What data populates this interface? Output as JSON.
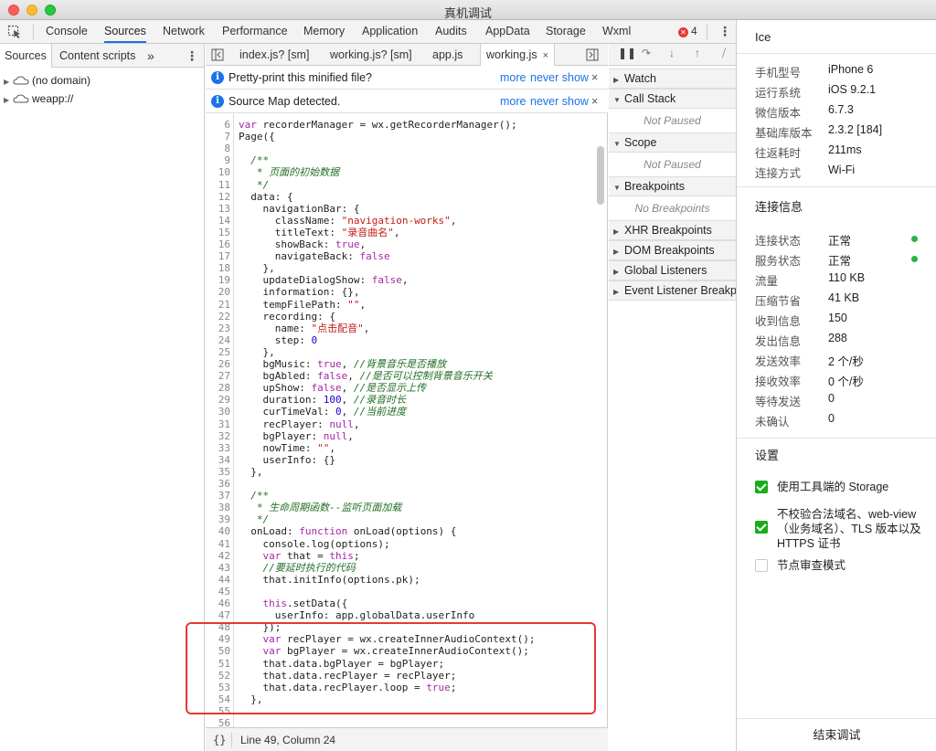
{
  "window": {
    "title": "真机调试"
  },
  "tabbar": {
    "tabs": [
      "Console",
      "Sources",
      "Network",
      "Performance",
      "Memory",
      "Application",
      "Audits",
      "AppData",
      "Storage",
      "Wxml"
    ],
    "active": "Sources",
    "error_count": "4"
  },
  "navigator": {
    "tabs": [
      "Sources",
      "Content scripts"
    ],
    "more": "»",
    "items": [
      "(no domain)",
      "weapp://"
    ]
  },
  "editor": {
    "tabs": [
      "index.js? [sm]",
      "working.js? [sm]",
      "app.js",
      "working.js"
    ],
    "close": "×",
    "infobars": [
      {
        "text": "Pretty-print this minified file?",
        "more": "more",
        "never": "never show",
        "close": "×"
      },
      {
        "text": "Source Map detected.",
        "more": "more",
        "never": "never show",
        "close": "×"
      }
    ],
    "status": {
      "braces": "{}",
      "position": "Line 49, Column 24"
    }
  },
  "debugger": {
    "sections": [
      {
        "label": "Watch",
        "expanded": false
      },
      {
        "label": "Call Stack",
        "expanded": true,
        "body": "Not Paused"
      },
      {
        "label": "Scope",
        "expanded": true,
        "body": "Not Paused"
      },
      {
        "label": "Breakpoints",
        "expanded": true,
        "body": "No Breakpoints"
      },
      {
        "label": "XHR Breakpoints",
        "expanded": false
      },
      {
        "label": "DOM Breakpoints",
        "expanded": false
      },
      {
        "label": "Global Listeners",
        "expanded": false
      },
      {
        "label": "Event Listener Breakpoints",
        "expanded": false
      }
    ]
  },
  "panel": {
    "title": "Ice",
    "device": [
      {
        "k": "手机型号",
        "v": "iPhone 6"
      },
      {
        "k": "运行系统",
        "v": "iOS 9.2.1"
      },
      {
        "k": "微信版本",
        "v": "6.7.3"
      },
      {
        "k": "基础库版本",
        "v": "2.3.2 [184]"
      },
      {
        "k": "往返耗时",
        "v": "211ms"
      },
      {
        "k": "连接方式",
        "v": "Wi-Fi"
      }
    ],
    "conn_title": "连接信息",
    "conn": [
      {
        "k": "连接状态",
        "v": "正常",
        "dot": true
      },
      {
        "k": "服务状态",
        "v": "正常",
        "dot": true
      },
      {
        "k": "流量",
        "v": "110 KB"
      },
      {
        "k": "压缩节省",
        "v": "41 KB"
      },
      {
        "k": "收到信息",
        "v": "150"
      },
      {
        "k": "发出信息",
        "v": "288"
      },
      {
        "k": "发送效率",
        "v": "2 个/秒"
      },
      {
        "k": "接收效率",
        "v": "0 个/秒"
      },
      {
        "k": "等待发送",
        "v": "0"
      },
      {
        "k": "未确认",
        "v": "0"
      }
    ],
    "settings_title": "设置",
    "settings": [
      {
        "label": "使用工具端的 Storage",
        "checked": true
      },
      {
        "label": "不校验合法域名、web-view（业务域名）、TLS 版本以及 HTTPS 证书",
        "checked": true
      },
      {
        "label": "节点审查模式",
        "checked": false
      }
    ],
    "end_button": "结束调试"
  },
  "colors": {
    "accent": "#1a73e8",
    "checkbox_green": "#1aad19",
    "status_green": "#2ab34b",
    "highlight_red": "#e53935"
  },
  "code": {
    "lines": [
      {
        "n": "6",
        "t": "var recorderManager = wx.getRecorderManager();"
      },
      {
        "n": "7",
        "t": "Page({"
      },
      {
        "n": "8",
        "t": ""
      },
      {
        "n": "9",
        "t": "  /**"
      },
      {
        "n": "10",
        "t": "   * 页面的初始数据"
      },
      {
        "n": "11",
        "t": "   */"
      },
      {
        "n": "12",
        "t": "  data: {"
      },
      {
        "n": "13",
        "t": "    navigationBar: {"
      },
      {
        "n": "14",
        "t": "      className: \"navigation-works\","
      },
      {
        "n": "15",
        "t": "      titleText: \"录音曲名\","
      },
      {
        "n": "16",
        "t": "      showBack: true,"
      },
      {
        "n": "17",
        "t": "      navigateBack: false"
      },
      {
        "n": "18",
        "t": "    },"
      },
      {
        "n": "19",
        "t": "    updateDialogShow: false,"
      },
      {
        "n": "20",
        "t": "    information: {},"
      },
      {
        "n": "21",
        "t": "    tempFilePath: \"\","
      },
      {
        "n": "22",
        "t": "    recording: {"
      },
      {
        "n": "23",
        "t": "      name: \"点击配音\","
      },
      {
        "n": "24",
        "t": "      step: 0"
      },
      {
        "n": "25",
        "t": "    },"
      },
      {
        "n": "26",
        "t": "    bgMusic: true, //背景音乐是否播放"
      },
      {
        "n": "27",
        "t": "    bgAbled: false, //是否可以控制背景音乐开关"
      },
      {
        "n": "28",
        "t": "    upShow: false, //是否显示上传"
      },
      {
        "n": "29",
        "t": "    duration: 100, //录音时长"
      },
      {
        "n": "30",
        "t": "    curTimeVal: 0, //当前进度"
      },
      {
        "n": "31",
        "t": "    recPlayer: null,"
      },
      {
        "n": "32",
        "t": "    bgPlayer: null,"
      },
      {
        "n": "33",
        "t": "    nowTime: \"\","
      },
      {
        "n": "34",
        "t": "    userInfo: {}"
      },
      {
        "n": "35",
        "t": "  },"
      },
      {
        "n": "36",
        "t": ""
      },
      {
        "n": "37",
        "t": "  /**"
      },
      {
        "n": "38",
        "t": "   * 生命周期函数--监听页面加载"
      },
      {
        "n": "39",
        "t": "   */"
      },
      {
        "n": "40",
        "t": "  onLoad: function onLoad(options) {"
      },
      {
        "n": "41",
        "t": "    console.log(options);"
      },
      {
        "n": "42",
        "t": "    var that = this;"
      },
      {
        "n": "43",
        "t": "    //要延时执行的代码"
      },
      {
        "n": "44",
        "t": "    that.initInfo(options.pk);"
      },
      {
        "n": "45",
        "t": ""
      },
      {
        "n": "46",
        "t": "    this.setData({"
      },
      {
        "n": "47",
        "t": "      userInfo: app.globalData.userInfo"
      },
      {
        "n": "48",
        "t": "    });"
      },
      {
        "n": "49",
        "t": "    var recPlayer = wx.createInnerAudioContext();"
      },
      {
        "n": "50",
        "t": "    var bgPlayer = wx.createInnerAudioContext();"
      },
      {
        "n": "51",
        "t": "    that.data.bgPlayer = bgPlayer;"
      },
      {
        "n": "52",
        "t": "    that.data.recPlayer = recPlayer;"
      },
      {
        "n": "53",
        "t": "    that.data.recPlayer.loop = true;"
      },
      {
        "n": "54",
        "t": "  },"
      },
      {
        "n": "55",
        "t": ""
      },
      {
        "n": "56",
        "t": ""
      }
    ]
  }
}
